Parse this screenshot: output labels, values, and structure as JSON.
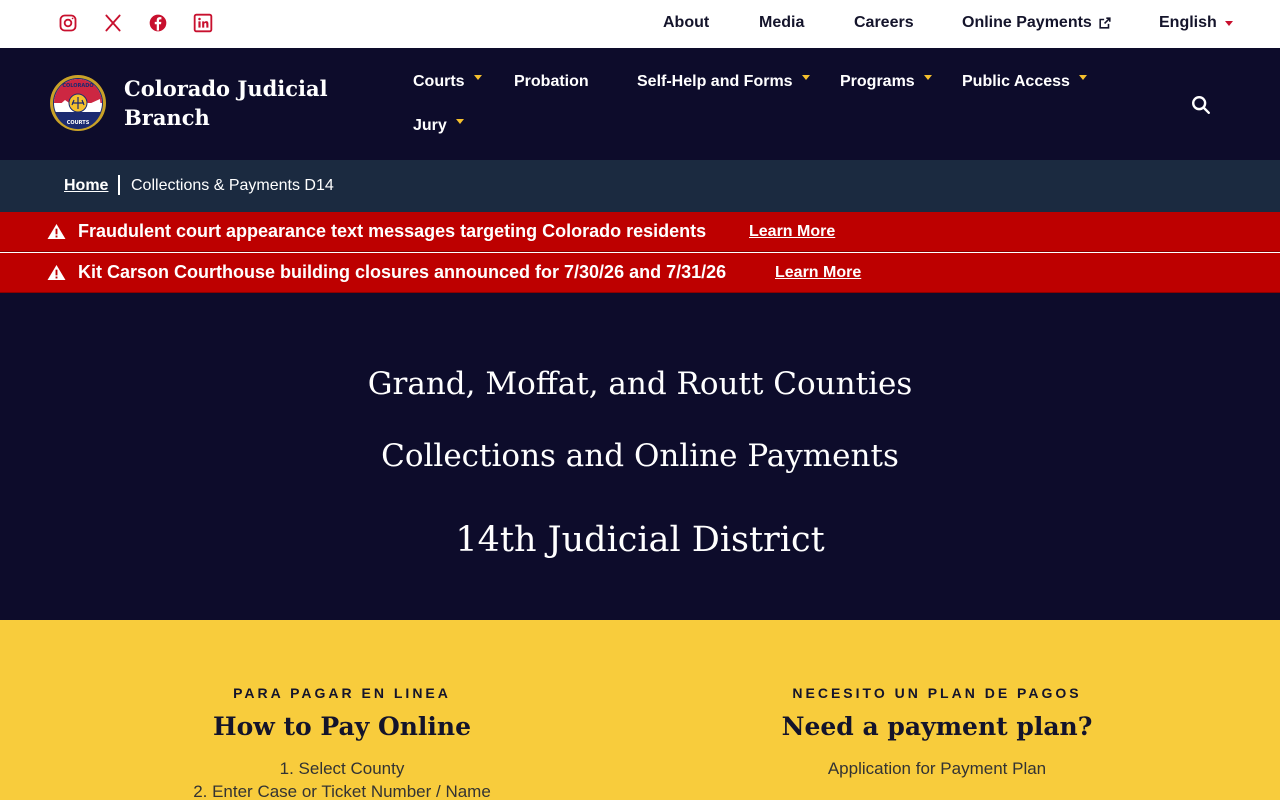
{
  "topbar": {
    "social": [
      "instagram-icon",
      "x-icon",
      "facebook-icon",
      "linkedin-icon"
    ],
    "links": {
      "about": "About",
      "media": "Media",
      "careers": "Careers",
      "online_payments": "Online Payments",
      "language": "English"
    }
  },
  "brand": {
    "name_line1": "Colorado Judicial",
    "name_line2": "Branch",
    "logo_text_top": "COLORADO",
    "logo_text_bottom": "COURTS"
  },
  "nav": {
    "courts": "Courts",
    "probation": "Probation",
    "self_help": "Self-Help and Forms",
    "programs": "Programs",
    "public_access": "Public Access",
    "jury": "Jury"
  },
  "breadcrumb": {
    "home": "Home",
    "current": "Collections & Payments D14"
  },
  "alerts": [
    {
      "text": "Fraudulent court appearance text messages targeting Colorado residents",
      "link": "Learn More"
    },
    {
      "text": "Kit Carson Courthouse building closures announced for 7/30/26 and 7/31/26",
      "link": "Learn More"
    }
  ],
  "hero": {
    "line1": "Grand, Moffat, and Routt Counties",
    "line2": "Collections and Online Payments",
    "line3": "14th Judicial District"
  },
  "sections": {
    "pay_online": {
      "eyebrow": "PARA PAGAR EN LINEA",
      "title": "How to Pay Online",
      "steps": [
        "1. Select County",
        "2. Enter Case or Ticket Number / Name"
      ]
    },
    "payment_plan": {
      "eyebrow": "NECESITO UN PLAN DE PAGOS",
      "title": "Need a payment plan?",
      "text": "Application for Payment Plan"
    }
  },
  "colors": {
    "navy": "#0d0c2b",
    "breadcrumb_bg": "#1b2a40",
    "alert_red": "#bd0000",
    "gold": "#f5c02d",
    "yellow_bg": "#f8cc3c",
    "social_red": "#c8102e"
  }
}
